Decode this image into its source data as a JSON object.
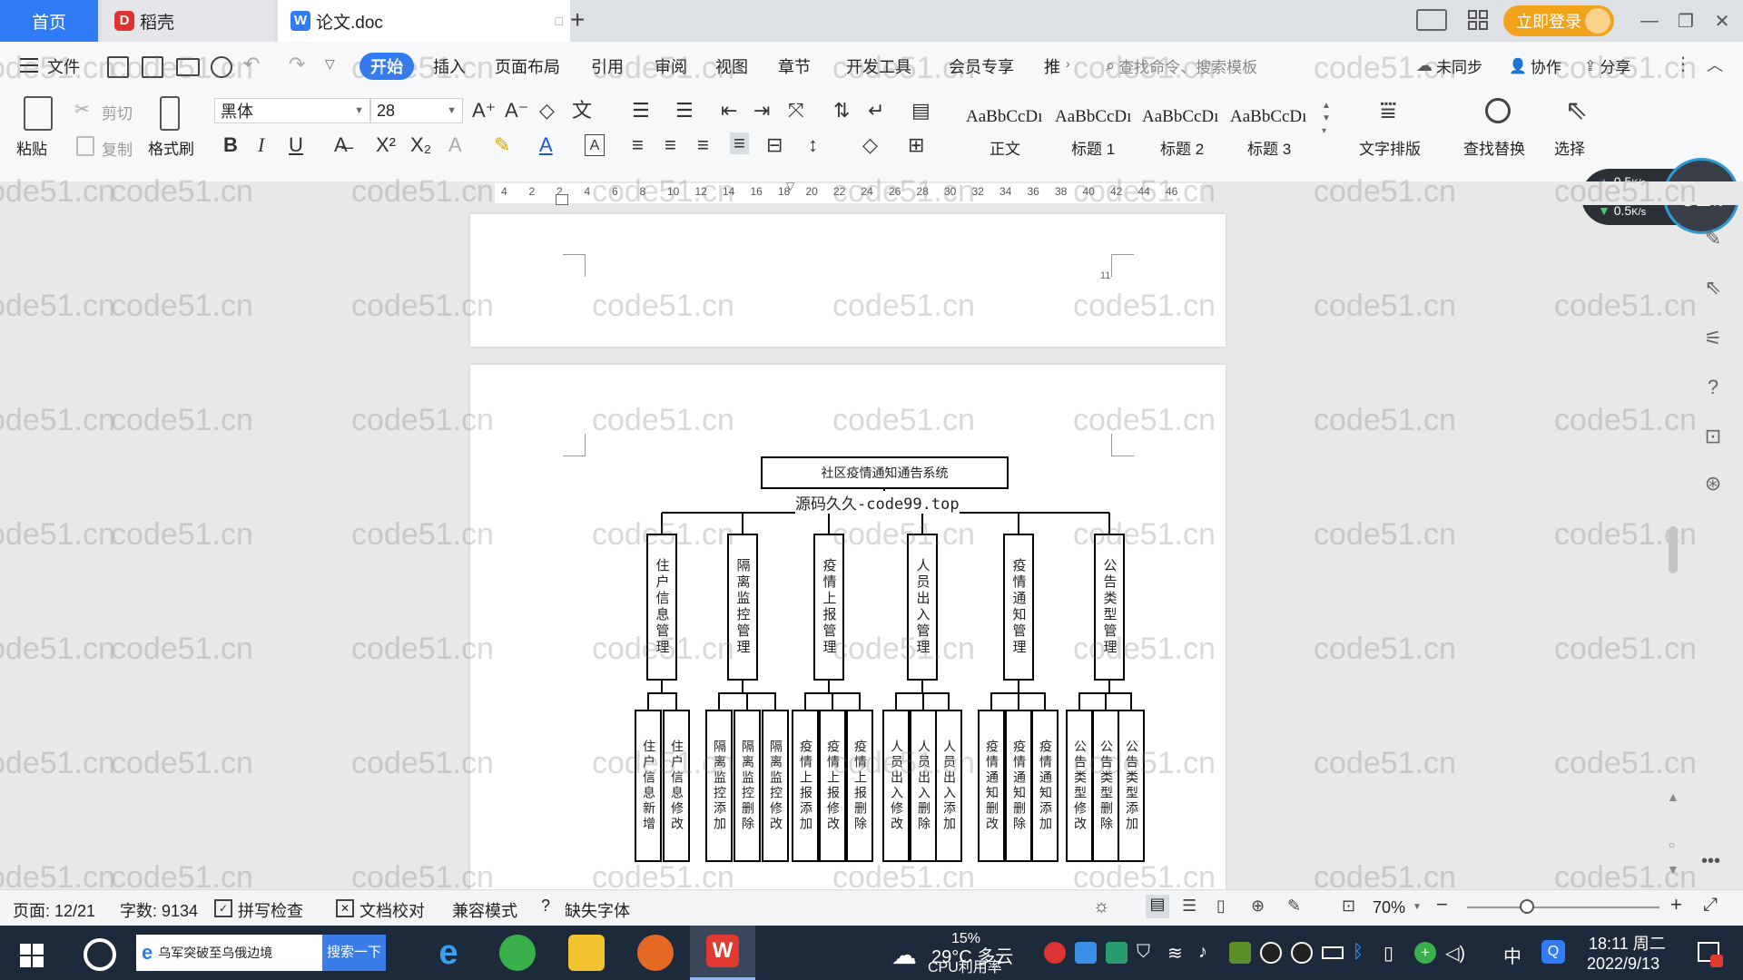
{
  "tabs": {
    "home": "首页",
    "daoke": "稻壳",
    "doc": "论文.doc",
    "new_tab": "+"
  },
  "window": {
    "login": "立即登录",
    "minimize": "—",
    "restore": "❐",
    "close": "✕"
  },
  "menu": {
    "file": "文件",
    "items": [
      "开始",
      "插入",
      "页面布局",
      "引用",
      "审阅",
      "视图",
      "章节",
      "开发工具",
      "会员专享",
      "推"
    ],
    "search_placeholder": "查找命令、搜索模板",
    "sync": "未同步",
    "collab": "协作",
    "share": "分享"
  },
  "ribbon": {
    "paste": "粘贴",
    "cut": "剪切",
    "copy": "复制",
    "format_painter": "格式刷",
    "font_name": "黑体",
    "font_size": "28",
    "styles": [
      {
        "preview": "AaBbCcDı",
        "name": "正文"
      },
      {
        "preview": "AaBbCcDı",
        "name": "标题 1"
      },
      {
        "preview": "AaBbCcDı",
        "name": "标题 2"
      },
      {
        "preview": "AaBbCcDı",
        "name": "标题 3"
      }
    ],
    "text_layout": "文字排版",
    "find_replace": "查找替换",
    "select": "选择"
  },
  "ruler": {
    "marks": [
      "4",
      "2",
      "2",
      "4",
      "6",
      "8",
      "10",
      "12",
      "14",
      "16",
      "18",
      "20",
      "22",
      "24",
      "26",
      "28",
      "30",
      "32",
      "34",
      "36",
      "38",
      "40",
      "42",
      "44",
      "46"
    ]
  },
  "netspeed": {
    "up": "0.5",
    "down": "0.5",
    "unit": "K/s",
    "percent": "62",
    "percent_unit": "%"
  },
  "document": {
    "page_number": "11",
    "diagram_title": "社区疫情通知通告系统",
    "source_text": "源码久久-code99.top",
    "modules": [
      {
        "name": "住户信息管理",
        "children": [
          "住户信息新增",
          "住户信息修改"
        ]
      },
      {
        "name": "隔离监控管理",
        "children": [
          "隔离监控添加",
          "隔离监控删除",
          "隔离监控修改"
        ]
      },
      {
        "name": "疫情上报管理",
        "children": [
          "疫情上报添加",
          "疫情上报修改",
          "疫情上报删除"
        ]
      },
      {
        "name": "人员出入管理",
        "children": [
          "人员出入修改",
          "人员出入删除",
          "人员出入添加"
        ]
      },
      {
        "name": "疫情通知管理",
        "children": [
          "疫情通知删改",
          "疫情通知删除",
          "疫情通知添加"
        ]
      },
      {
        "name": "公告类型管理",
        "children": [
          "公告类型修改",
          "公告类型删除",
          "公告类型添加"
        ]
      }
    ]
  },
  "watermark": "code51.cn",
  "status": {
    "page": "页面: 12/21",
    "words": "字数: 9134",
    "spell": "拼写检查",
    "proof": "文档校对",
    "compat": "兼容模式",
    "missing_font": "缺失字体",
    "zoom": "70%"
  },
  "taskbar": {
    "search_text": "乌军突破至乌俄边境",
    "search_btn": "搜索一下",
    "weather": "29°C 多云",
    "cpu": "15%",
    "cpu_label": "CPU利用率",
    "ime": "中",
    "time": "18:11 周二",
    "date": "2022/9/13"
  }
}
